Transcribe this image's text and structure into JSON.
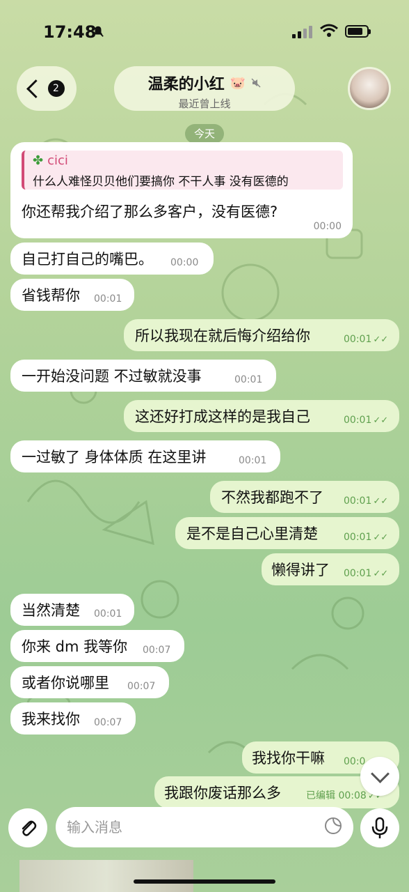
{
  "status_bar": {
    "time": "17:48"
  },
  "header": {
    "back_count": "2",
    "chat_name": "温柔的小红",
    "chat_status": "最近曾上线"
  },
  "date_divider": "今天",
  "reply_message": {
    "quote_author": "cici",
    "quote_text": "什么人难怪贝贝他们要搞你 不干人事 没有医德的",
    "text": "你还帮我介绍了那么多客户，没有医德?",
    "time": "00:00"
  },
  "messages": [
    {
      "text": "自己打自己的嘴巴。",
      "time": "00:00"
    },
    {
      "text": "省钱帮你",
      "time": "00:01"
    },
    {
      "text": "所以我现在就后悔介绍给你",
      "time": "00:01"
    },
    {
      "text": "一开始没问题 不过敏就没事",
      "time": "00:01"
    },
    {
      "text": "这还好打成这样的是我自己",
      "time": "00:01"
    },
    {
      "text": "一过敏了 身体体质 在这里讲",
      "time": "00:01"
    },
    {
      "text": "不然我都跑不了",
      "time": "00:01"
    },
    {
      "text": "是不是自己心里清楚",
      "time": "00:01"
    },
    {
      "text": "懒得讲了",
      "time": "00:01"
    },
    {
      "text": "当然清楚",
      "time": "00:01"
    },
    {
      "text": "你来 dm 我等你",
      "time": "00:07"
    },
    {
      "text": "或者你说哪里",
      "time": "00:07"
    },
    {
      "text": "我来找你",
      "time": "00:07"
    },
    {
      "text": "我找你干嘛",
      "time": "00:0"
    },
    {
      "text": "我跟你废话那么多",
      "time": "00:08",
      "edited": "已编辑"
    }
  ],
  "composer": {
    "placeholder": "输入消息"
  },
  "colors": {
    "incoming": "#ffffff",
    "outgoing": "#e6f5cf",
    "accent": "#5fa04e",
    "quote_accent": "#d24a76"
  }
}
